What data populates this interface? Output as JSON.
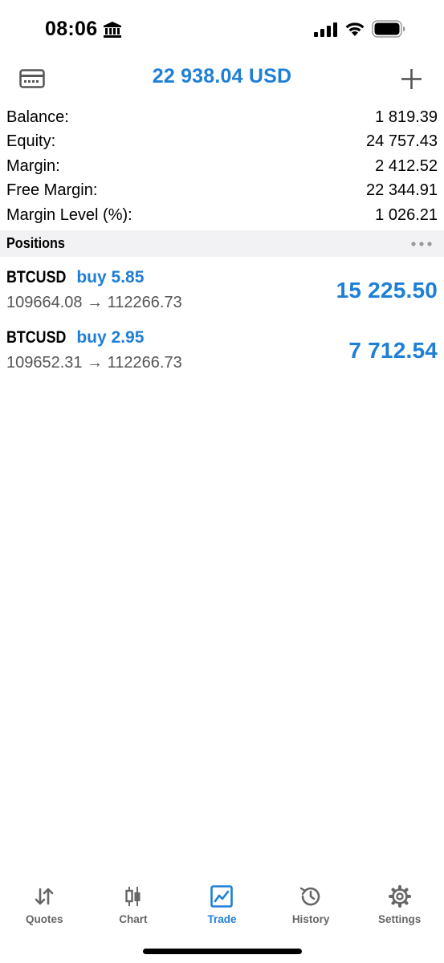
{
  "status_bar": {
    "time": "08:06",
    "icons": [
      "bank-icon",
      "cellular-signal-icon",
      "wifi-icon",
      "battery-icon"
    ]
  },
  "header": {
    "title": "22 938.04 USD",
    "left_icon": "account-card-icon",
    "right_icon": "plus-icon"
  },
  "summary": [
    {
      "label": "Balance:",
      "value": "1 819.39"
    },
    {
      "label": "Equity:",
      "value": "24 757.43"
    },
    {
      "label": "Margin:",
      "value": "2 412.52"
    },
    {
      "label": "Free Margin:",
      "value": "22 344.91"
    },
    {
      "label": "Margin Level (%):",
      "value": "1 026.21"
    }
  ],
  "positions_section": {
    "title": "Positions",
    "menu_icon": "more-icon"
  },
  "positions": [
    {
      "symbol": "BTCUSD",
      "type": "buy 5.85",
      "prices": "109664.08 → 112266.73",
      "profit": "15 225.50"
    },
    {
      "symbol": "BTCUSD",
      "type": "buy 2.95",
      "prices": "109652.31 → 112266.73",
      "profit": "7 712.54"
    }
  ],
  "tabs": [
    {
      "label": "Quotes",
      "icon": "quotes-icon",
      "active": false
    },
    {
      "label": "Chart",
      "icon": "chart-icon",
      "active": false
    },
    {
      "label": "Trade",
      "icon": "trade-icon",
      "active": true
    },
    {
      "label": "History",
      "icon": "history-icon",
      "active": false
    },
    {
      "label": "Settings",
      "icon": "gear-icon",
      "active": false
    }
  ],
  "colors": {
    "accent": "#1e7fd6",
    "section_bg": "#f2f2f4",
    "inactive_tab": "#666666"
  }
}
